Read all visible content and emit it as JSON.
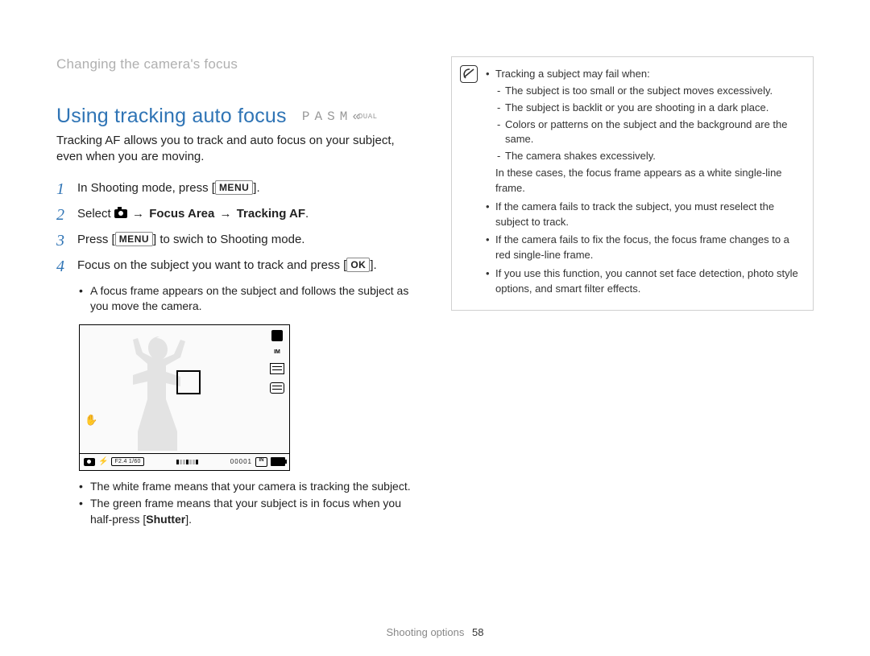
{
  "breadcrumb": "Changing the camera's focus",
  "section": {
    "title": "Using tracking auto focus",
    "modes": [
      "P",
      "A",
      "S",
      "M"
    ],
    "mode_dual": "DUAL",
    "intro": "Tracking AF allows you to track and auto focus on your subject, even when you are moving."
  },
  "steps": {
    "s1": {
      "num": "1",
      "pre": "In Shooting mode, press [",
      "post": "]."
    },
    "s2": {
      "num": "2",
      "pre": "Select ",
      "arrow": " → ",
      "b1": "Focus Area",
      "b2": "Tracking AF",
      "end": "."
    },
    "s3": {
      "num": "3",
      "pre": "Press [",
      "post": "] to swich to Shooting mode."
    },
    "s4": {
      "num": "4",
      "pre": "Focus on the subject you want to track and press [",
      "ok": "OK",
      "post": "]."
    }
  },
  "menu_label": "MENU",
  "step4_bullets": {
    "a": "A focus frame appears on the subject and follows the subject as you move the camera."
  },
  "below_lcd_bullets": {
    "a": "The white frame means that your camera is tracking the subject.",
    "b_pre": "The green frame means that your subject is in focus when you half-press [",
    "b_bold": "Shutter",
    "b_post": "]."
  },
  "lcd": {
    "side_label": "IM",
    "exposure": "F2.4  1/60",
    "counter": "00001",
    "card_label": "IN"
  },
  "note": {
    "lead": "Tracking a subject may fail when:",
    "sub": {
      "a": "The subject is too small or the subject moves excessively.",
      "b": "The subject is backlit or you are shooting in a dark place.",
      "c": "Colors or patterns on the subject and the background are the same.",
      "d": "The camera shakes excessively."
    },
    "after_sub": "In these cases, the focus frame appears as a white single-line frame.",
    "items": {
      "b": "If the camera fails to track the subject, you must reselect the subject to track.",
      "c": "If the camera fails to fix the focus, the focus frame changes to a red single-line frame.",
      "d": "If you use this function, you cannot set face detection, photo style options, and smart filter effects."
    }
  },
  "footer": {
    "section": "Shooting options",
    "page": "58"
  }
}
